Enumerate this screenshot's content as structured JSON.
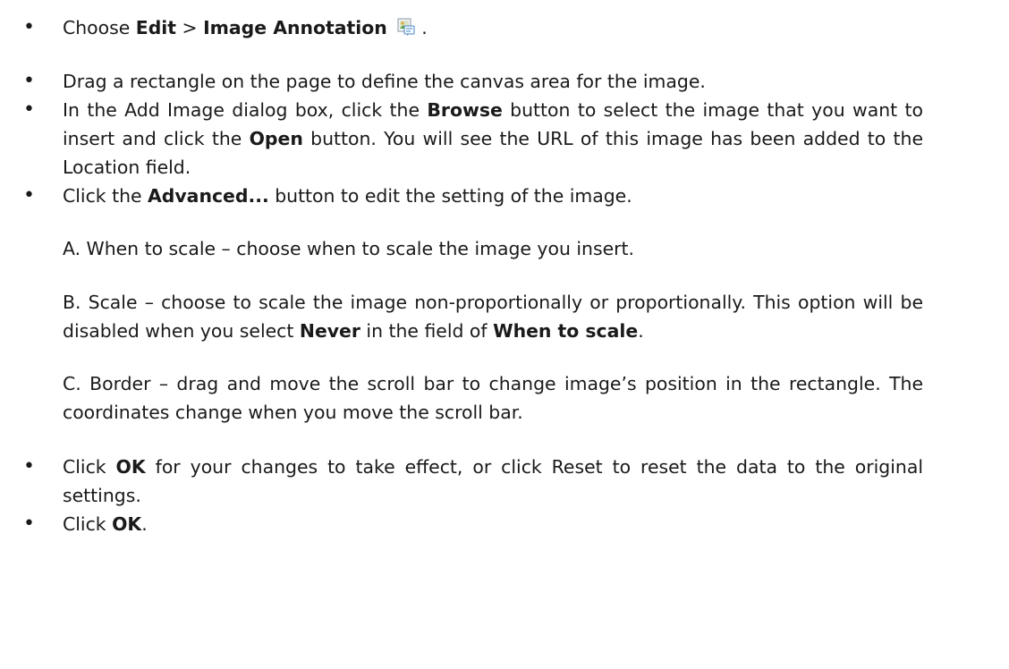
{
  "steps": [
    {
      "bullet": "•",
      "pre": "Choose ",
      "b1": "Edit",
      "mid": " > ",
      "b2": "Image Annotation",
      "post": " .",
      "icon": "image-annotation-icon"
    },
    {
      "bullet": "•",
      "text": "Drag a rectangle on the page to define the canvas area for the image."
    },
    {
      "bullet": "•",
      "pre": "In the Add Image dialog box, click the ",
      "b1": "Browse",
      "mid": " button to select the image that you want to insert and click the ",
      "b2": "Open",
      "post": " button. You will see the URL of this image has been added to the Location field."
    },
    {
      "bullet": "•",
      "pre": "Click the ",
      "b1": "Advanced...",
      "post": " button to edit the setting of the image."
    },
    {
      "bullet": "•",
      "pre": "Click ",
      "b1": "OK",
      "post": " for your changes to take effect, or click Reset to reset the data to the original settings."
    },
    {
      "bullet": "•",
      "pre": "Click ",
      "b1": "OK",
      "post": "."
    }
  ],
  "sub_items": [
    {
      "text": "A. When to scale – choose when to scale the image you insert."
    },
    {
      "pre": "B. Scale – choose to scale the image non-proportionally or proportionally. This option will be disabled when you select ",
      "b1": "Never",
      "mid": " in the field of ",
      "b2": "When to scale",
      "post": "."
    },
    {
      "text": "C. Border – drag and move the scroll bar to change image’s position in the rectangle. The coordinates change when you move the scroll bar."
    }
  ]
}
